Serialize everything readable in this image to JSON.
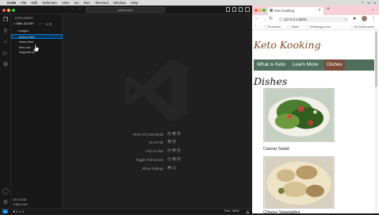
{
  "menubar": {
    "items": [
      "Code",
      "File",
      "Edit",
      "Selection",
      "View",
      "Go",
      "Run",
      "Terminal",
      "Window",
      "Help"
    ]
  },
  "vscode": {
    "search_placeholder": "ystart-start",
    "sidebar": {
      "explorer_label": "EXPLORER",
      "folder_label": "> ÌMN‑START",
      "files": [
        "images",
        "dishes.html",
        "index.html",
        "keto.css",
        "snippets.txt"
      ],
      "outline_label": "OUTLINE",
      "timeline_label": "TIMELINE"
    },
    "editor": {
      "commands": [
        {
          "label": "Show All Commands",
          "keys": [
            "⇧",
            "⌘",
            "P"
          ]
        },
        {
          "label": "Go to File",
          "keys": [
            "⌘",
            "P"
          ]
        },
        {
          "label": "Find in Files",
          "keys": [
            "⇧",
            "⌘",
            "F"
          ]
        },
        {
          "label": "Toggle Full Screen",
          "keys": [
            "^",
            "⌘",
            "F"
          ]
        },
        {
          "label": "Show Settings",
          "keys": [
            "⌘",
            ","
          ]
        }
      ]
    },
    "status": {
      "left": "⊗ 0 ⚠ 0",
      "port": "Port : 5500"
    }
  },
  "chrome": {
    "tab_title": "Keto Kooking",
    "url": "127.0.0.1:5500...",
    "bookmarks": [
      "Business",
      "Tablet",
      "Whatsapp.com"
    ],
    "all_bookmarks": "All Bookmarks",
    "page": {
      "title": "Keto Kooking",
      "nav": [
        "What is Keto",
        "Learn More",
        "Dishes"
      ],
      "heading": "Dishes",
      "dishes": [
        "Caesar Salad",
        "Cheesy Vegetables"
      ]
    }
  },
  "colors": {
    "nav_bg": "#4f6e5b",
    "nav_active": "#7a4b3a",
    "title_color": "#8a4b2a",
    "tabbar_bg": "#f6d0d6"
  }
}
